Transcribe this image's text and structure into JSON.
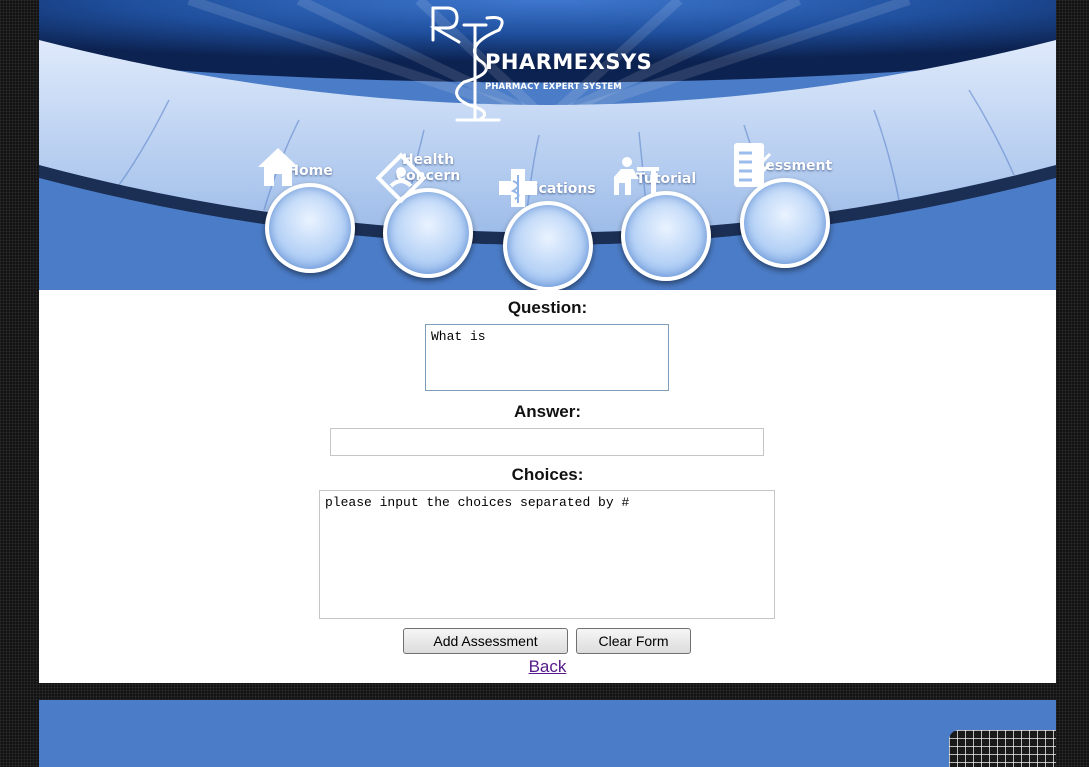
{
  "header": {
    "logo_title": "PHARMEXSYS",
    "logo_subtitle": "PHARMACY EXPERT SYSTEM",
    "nav": [
      {
        "label": "Home",
        "icon": "house-icon"
      },
      {
        "label": "Health\nConcern",
        "icon": "health-badge-icon"
      },
      {
        "label": "Medications",
        "icon": "medical-cross-icon"
      },
      {
        "label": "Tutorial",
        "icon": "student-desk-icon"
      },
      {
        "label": "Assessment",
        "icon": "checklist-icon"
      }
    ]
  },
  "form": {
    "question_label": "Question:",
    "question_value": "What is",
    "answer_label": "Answer:",
    "answer_value": "",
    "choices_label": "Choices:",
    "choices_value": "please input the choices separated by #",
    "add_button": "Add Assessment",
    "clear_button": "Clear Form",
    "back_link": "Back"
  },
  "colors": {
    "brand_blue": "#4b7cc7",
    "link_visited": "#551a8b"
  }
}
